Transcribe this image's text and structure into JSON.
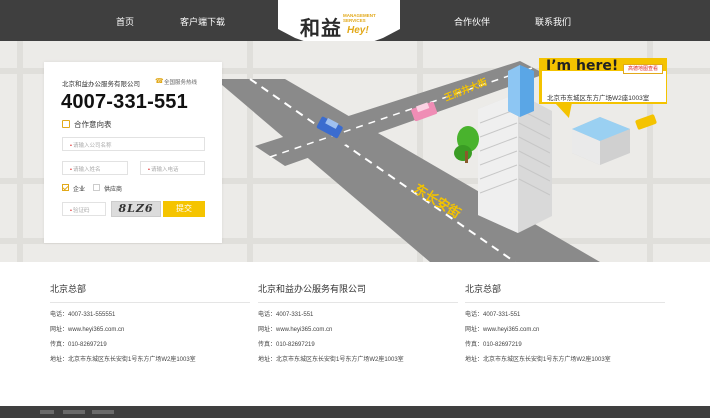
{
  "nav": {
    "items": [
      "首页",
      "客户端下载",
      "合作伙伴",
      "联系我们"
    ]
  },
  "logo": {
    "cn": "和益",
    "en_line1": "MANAGEMENT",
    "en_line2": "SERVICES",
    "hey": "Hey!"
  },
  "form": {
    "company": "北京和益办公服务有限公司",
    "hotline_label": "全国服务热线",
    "phone": "4007-331-551",
    "intent_title": "合作意向表",
    "company_placeholder": "请输入公司名称",
    "name_placeholder": "请输入姓名",
    "tel_placeholder": "请输入电话",
    "type_options": [
      {
        "label": "企业",
        "checked": true
      },
      {
        "label": "供应商",
        "checked": false
      }
    ],
    "captcha_placeholder": "验证码",
    "captcha_text": "8LZ6",
    "submit_label": "提交"
  },
  "map": {
    "road_label_1": "王府井大街",
    "road_label_2": "东长安街",
    "callout_title": "I’m here!",
    "callout_address": "北京市东城区东方广场W2座1003室",
    "map_link": "高德地图查看"
  },
  "offices": [
    {
      "title": "北京总部",
      "phone": "电话：4007-331-555551",
      "web": "网址：www.heyi365.com.cn",
      "fax": "传真：010-82697219",
      "address": "地址：北京市东城区东长安街1号东方广场W2座1003室"
    },
    {
      "title": "北京和益办公服务有限公司",
      "phone": "电话：4007-331-551",
      "web": "网址：www.heyi365.com.cn",
      "fax": "传真：010-82697219",
      "address": "地址：北京市东城区东长安街1号东方广场W2座1003室"
    },
    {
      "title": "北京总部",
      "phone": "电话：4007-331-551",
      "web": "网址：www.heyi365.com.cn",
      "fax": "传真：010-82697219",
      "address": "地址：北京市东城区东长安街1号东方广场W2座1003室"
    }
  ],
  "colors": {
    "header": "#3f3f3f",
    "accent": "#f4c300",
    "map_bg": "#ecebe8",
    "road": "#8a8a8a"
  }
}
